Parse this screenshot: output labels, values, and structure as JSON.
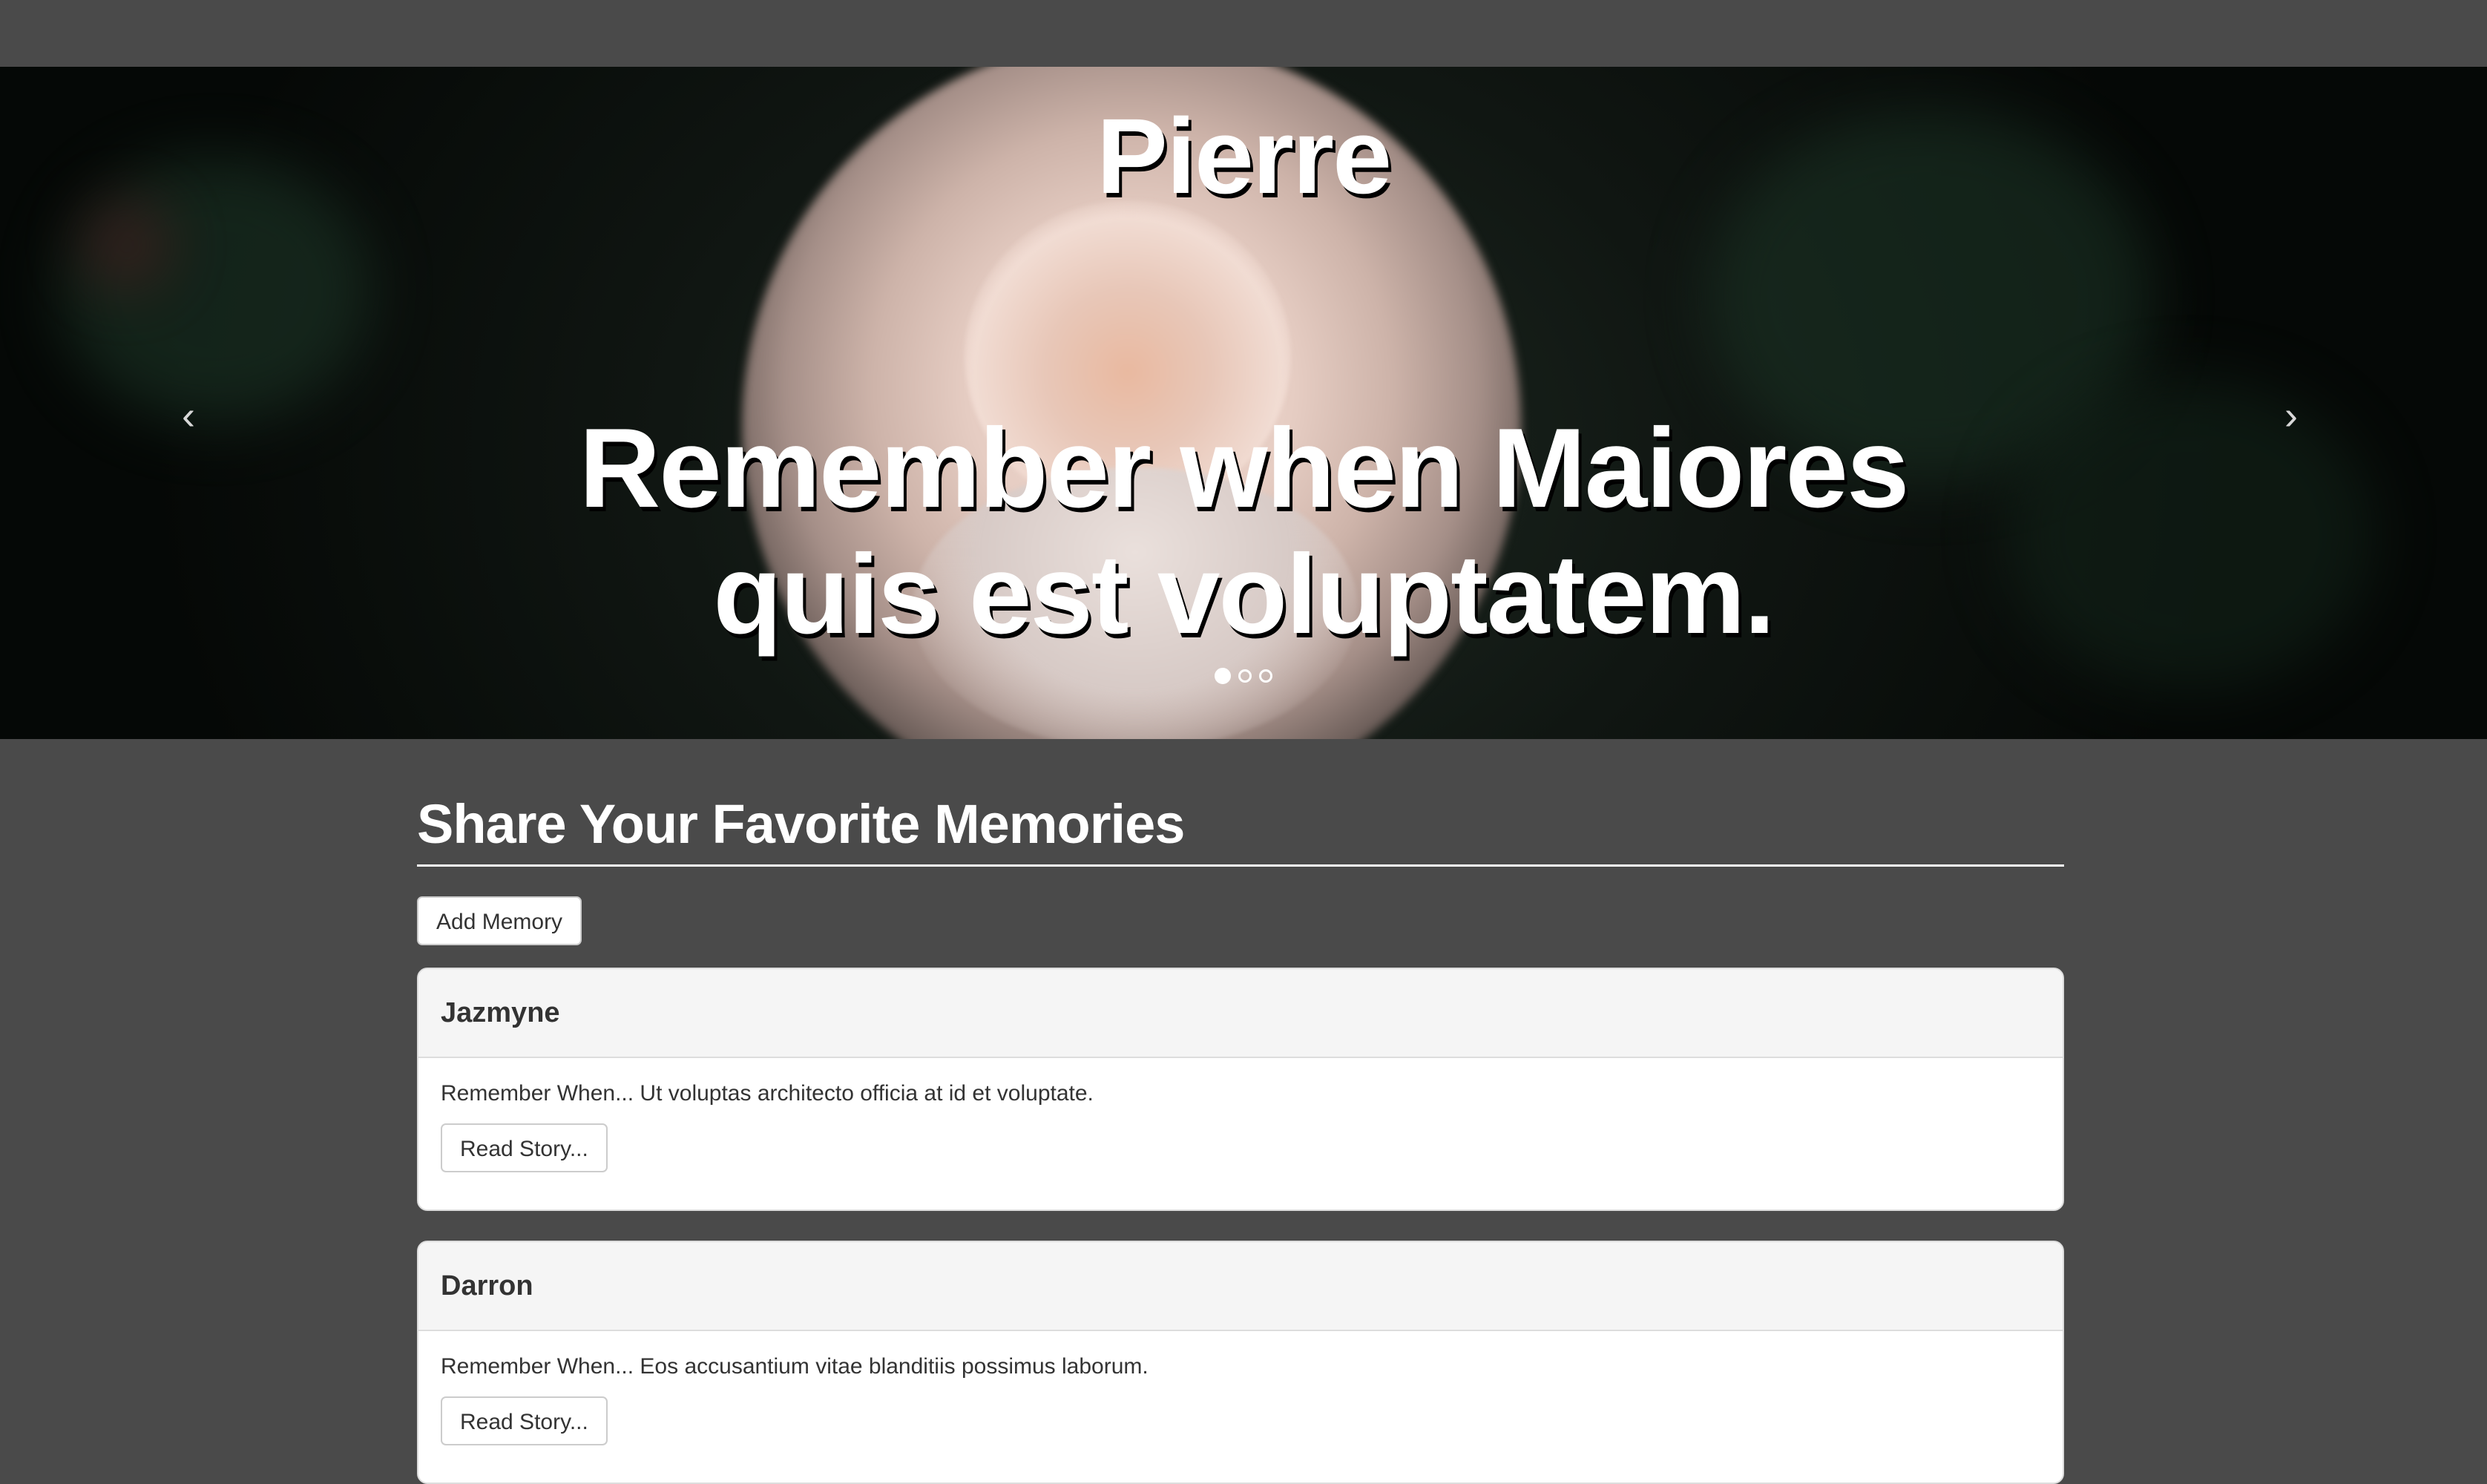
{
  "hero": {
    "name": "Pierre",
    "quote": "Remember when Maiores quis est voluptatem.",
    "prev_icon": "chevron-left-icon",
    "next_icon": "chevron-right-icon",
    "prev_glyph": "‹",
    "next_glyph": "›",
    "slides_total": 3,
    "active_slide": 1
  },
  "memories": {
    "title": "Share Your Favorite Memories",
    "add_button": "Add Memory",
    "cards": [
      {
        "author": "Jazmyne",
        "text": "Remember When... Ut voluptas architecto officia at id et voluptate.",
        "button": "Read Story..."
      },
      {
        "author": "Darron",
        "text": "Remember When... Eos accusantium vitae blanditiis possimus laborum.",
        "button": "Read Story..."
      }
    ]
  },
  "colors": {
    "page_background": "#4a4a4a",
    "card_header": "#f5f5f5",
    "text_on_dark": "#ffffff"
  }
}
